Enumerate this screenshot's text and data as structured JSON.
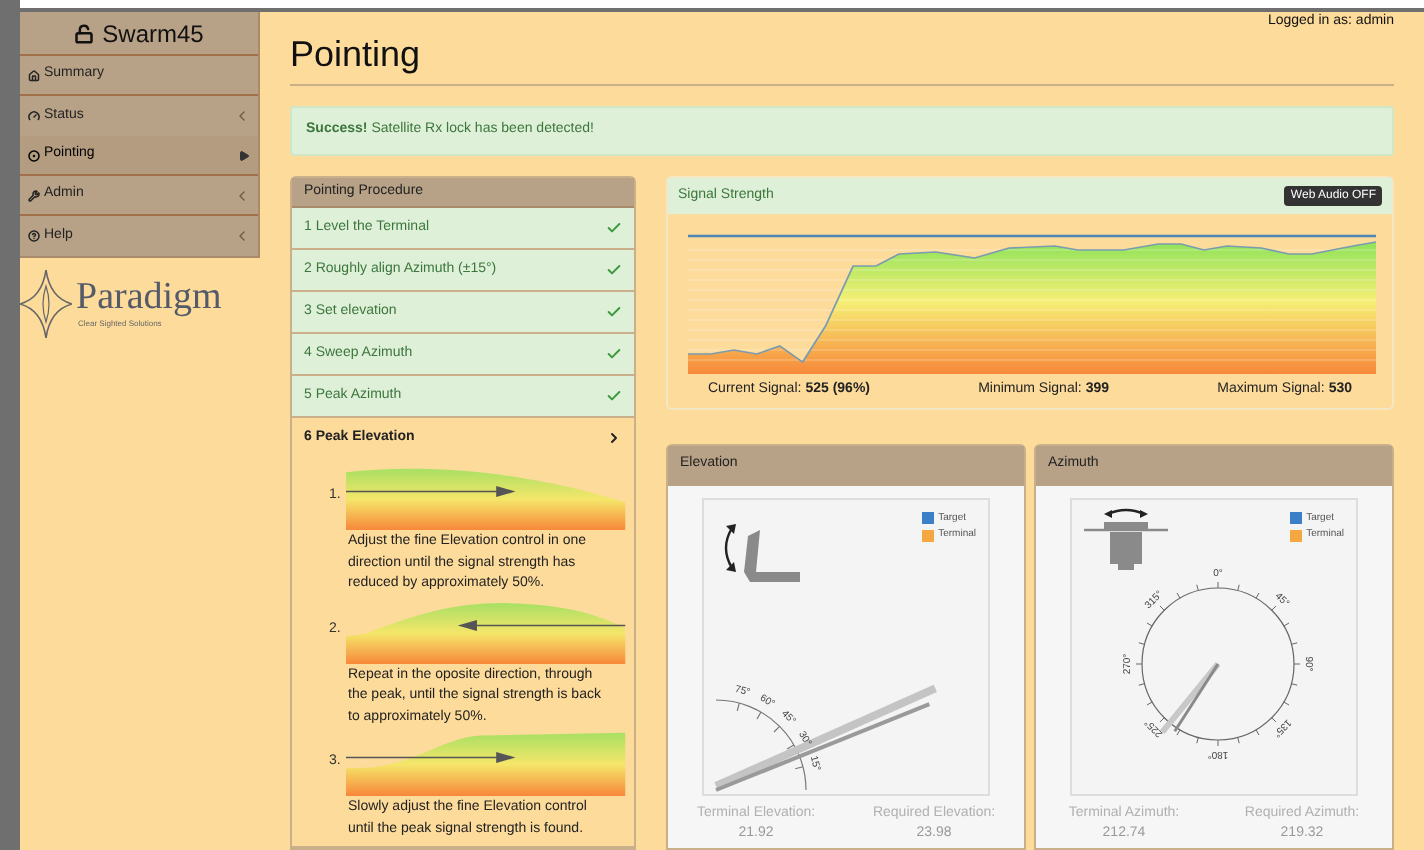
{
  "sidebar": {
    "title": "Swarm45",
    "items": [
      {
        "label": "Summary",
        "selected": false,
        "kind": "plain"
      },
      {
        "label": "Status",
        "selected": false,
        "kind": "submenu"
      },
      {
        "label": "Pointing",
        "selected": true,
        "kind": "current"
      },
      {
        "label": "Admin",
        "selected": false,
        "kind": "submenu"
      },
      {
        "label": "Help",
        "selected": false,
        "kind": "submenu"
      }
    ]
  },
  "logo": {
    "name": "Paradigm",
    "tagline": "Clear Sighted Solutions"
  },
  "user": "Logged in as: admin",
  "page_title": "Pointing",
  "alert": "**Success!** Satellite Rx lock has been detected!",
  "procedure": {
    "title": "Pointing Procedure",
    "steps": [
      {
        "label": "1 Level the Terminal",
        "done": true,
        "expanded": false
      },
      {
        "label": "2 Roughly align Azimuth (±15°)",
        "done": true,
        "expanded": false
      },
      {
        "label": "3 Set elevation",
        "done": true,
        "expanded": false
      },
      {
        "label": "4 Sweep Azimuth",
        "done": true,
        "expanded": false
      },
      {
        "label": "5 Peak Azimuth",
        "done": true,
        "expanded": false
      },
      {
        "label": "6 Peak Elevation",
        "done": false,
        "expanded": true,
        "instructions": [
          {
            "number": "1.",
            "kind": "rightward",
            "text": "Adjust the fine Elevation control in one direction until the signal strength has reduced by approximately 50%."
          },
          {
            "number": "2.",
            "kind": "leftward",
            "text": "Repeat in the oposite direction, through the peak, until the signal strength is back to approximately 50%."
          },
          {
            "number": "3.",
            "kind": "rightward",
            "text": "Slowly adjust the fine Elevation control until the peak signal strength is found."
          }
        ]
      }
    ]
  },
  "signal": {
    "title": "Signal Strength",
    "audio_button": "Web Audio OFF",
    "readings": [
      {
        "label": "Current Signal:",
        "value": "525 (96%)"
      },
      {
        "label": "Minimum Signal:",
        "value": "399"
      },
      {
        "label": "Maximum Signal:",
        "value": "530"
      }
    ]
  },
  "elevation": {
    "title": "Elevation",
    "legend": [
      {
        "label": "Target",
        "color": "#3a7fc8"
      },
      {
        "label": "Terminal",
        "color": "#f5a742"
      }
    ],
    "scale": [
      "75°",
      "60°",
      "45°",
      "30°",
      "15°"
    ],
    "readings": [
      {
        "label": "Terminal Elevation:",
        "value": "21.92"
      },
      {
        "label": "Required Elevation:",
        "value": "23.98"
      }
    ]
  },
  "azimuth": {
    "title": "Azimuth",
    "legend": [
      {
        "label": "Target",
        "color": "#3a7fc8"
      },
      {
        "label": "Terminal",
        "color": "#f5a742"
      }
    ],
    "scale": [
      "0°",
      "45°",
      "90°",
      "135°",
      "180°",
      "225°",
      "270°",
      "315°"
    ],
    "readings": [
      {
        "label": "Terminal Azimuth:",
        "value": "212.74"
      },
      {
        "label": "Required Azimuth:",
        "value": "219.32"
      }
    ]
  }
}
